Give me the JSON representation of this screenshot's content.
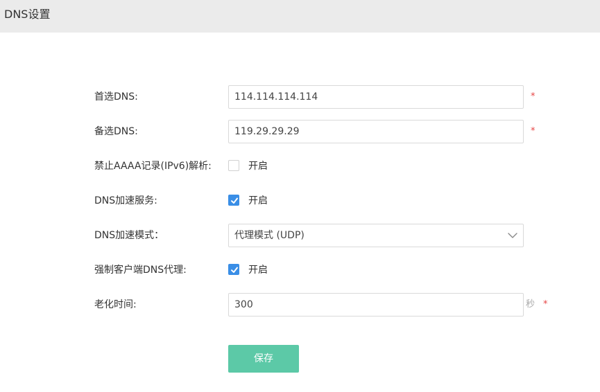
{
  "header": {
    "title": "DNS设置"
  },
  "form": {
    "primary_dns": {
      "label": "首选DNS:",
      "value": "114.114.114.114",
      "required": "*"
    },
    "secondary_dns": {
      "label": "备选DNS:",
      "value": "119.29.29.29",
      "required": "*"
    },
    "disable_aaaa": {
      "label": "禁止AAAA记录(IPv6)解析:",
      "option": "开启",
      "checked": false
    },
    "dns_acceleration": {
      "label": "DNS加速服务:",
      "option": "开启",
      "checked": true
    },
    "acceleration_mode": {
      "label": "DNS加速模式：",
      "selected": "代理模式 (UDP)",
      "icon": "chevron-down-icon"
    },
    "force_proxy": {
      "label": "强制客户端DNS代理:",
      "option": "开启",
      "checked": true
    },
    "aging_time": {
      "label": "老化时间:",
      "value": "300",
      "unit": "秒",
      "required": "*"
    }
  },
  "actions": {
    "save_label": "保存"
  },
  "colors": {
    "header_bg": "#ebebeb",
    "checkbox_checked": "#3a8ee6",
    "required_mark": "#e64545",
    "save_button": "#5cc9a7"
  }
}
